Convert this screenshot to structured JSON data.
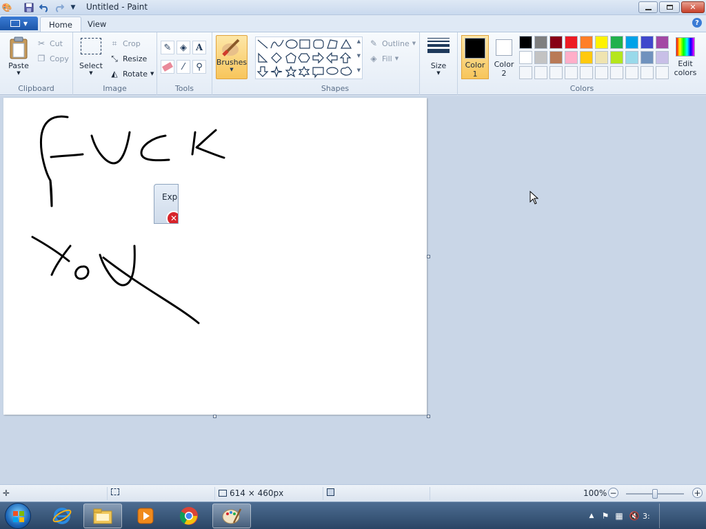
{
  "window": {
    "title": "Untitled - Paint",
    "minimize_icon": "minimize-icon",
    "maximize_icon": "restore-icon",
    "close_icon": "close-icon"
  },
  "tabs": [
    {
      "label": "Home",
      "active": true
    },
    {
      "label": "View",
      "active": false
    }
  ],
  "ribbon": {
    "clipboard": {
      "label": "Clipboard",
      "paste": "Paste",
      "cut": "Cut",
      "copy": "Copy"
    },
    "image": {
      "label": "Image",
      "select": "Select",
      "crop": "Crop",
      "resize": "Resize",
      "rotate": "Rotate"
    },
    "tools": {
      "label": "Tools"
    },
    "brushes": {
      "label": "Brushes"
    },
    "shapes": {
      "label": "Shapes",
      "outline": "Outline",
      "fill": "Fill"
    },
    "size": {
      "label": "Size"
    },
    "colors": {
      "label": "Colors",
      "color1_line1": "Color",
      "color1_line2": "1",
      "color2_line1": "Color",
      "color2_line2": "2",
      "edit_line1": "Edit",
      "edit_line2": "colors",
      "color1_value": "#000000",
      "color2_value": "#ffffff",
      "palette_row1": [
        "#000000",
        "#7f7f7f",
        "#880015",
        "#ed1c24",
        "#ff7f27",
        "#fff200",
        "#22b14c",
        "#00a2e8",
        "#3f48cc",
        "#a349a4"
      ],
      "palette_row2": [
        "#ffffff",
        "#c3c3c3",
        "#b97a57",
        "#ffaec9",
        "#ffc90e",
        "#efe4b0",
        "#b5e61d",
        "#99d9ea",
        "#7092be",
        "#c8bfe7"
      ]
    }
  },
  "canvas": {
    "ghost_dialog_title": "Explo"
  },
  "status": {
    "dimensions": "614 × 460px",
    "zoom": "100%"
  },
  "taskbar": {
    "clock_fragment": "3:"
  }
}
